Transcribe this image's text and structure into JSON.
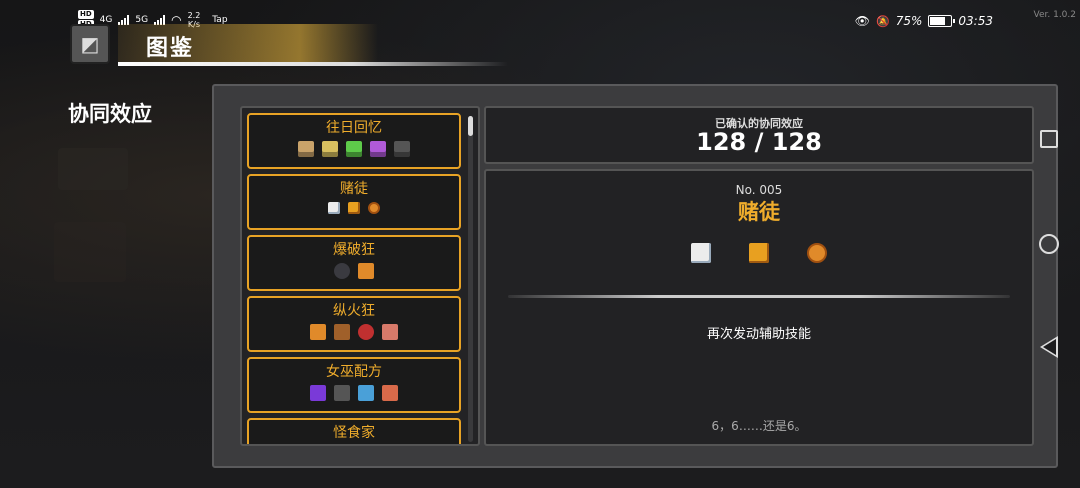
{
  "status_bar": {
    "hd1": "HD",
    "hd2": "HD",
    "net1": "4G",
    "net2": "5G",
    "speed_value": "2.2",
    "speed_unit": "K/s",
    "app_label": "Tap",
    "battery_percent": "75%",
    "battery_level": 0.75,
    "time": "03:53",
    "version": "Ver. 1.0.2"
  },
  "header": {
    "title": "图鉴",
    "back_icon": "back-arrow-icon"
  },
  "side_title": "协同效应",
  "synergy_list": [
    {
      "name": "往日回忆",
      "icons": [
        {
          "name": "memory-card-tan-icon",
          "color": "#c9a36a"
        },
        {
          "name": "memory-card-gold-icon",
          "color": "#d8c060"
        },
        {
          "name": "memory-card-green-icon",
          "color": "#5ecb4a"
        },
        {
          "name": "memory-card-purple-icon",
          "color": "#b05ad8"
        },
        {
          "name": "memory-card-dark-icon",
          "color": "#555555"
        }
      ]
    },
    {
      "name": "赌徒",
      "icons": [
        {
          "name": "dice-white-icon",
          "color": "#ececec"
        },
        {
          "name": "dice-gold-icon",
          "color": "#e8a020"
        },
        {
          "name": "chip-icon",
          "color": "#e08a2a"
        }
      ]
    },
    {
      "name": "爆破狂",
      "icons": [
        {
          "name": "bomb-icon",
          "color": "#3a3a40"
        },
        {
          "name": "boomerang-icon",
          "color": "#e08a2a"
        }
      ]
    },
    {
      "name": "纵火狂",
      "icons": [
        {
          "name": "boomerang-fire-icon",
          "color": "#e08a2a"
        },
        {
          "name": "fire-log-icon",
          "color": "#a0602a"
        },
        {
          "name": "red-orb-icon",
          "color": "#c03030"
        },
        {
          "name": "meat-icon",
          "color": "#d87a6a"
        }
      ]
    },
    {
      "name": "女巫配方",
      "icons": [
        {
          "name": "potion-purple-icon",
          "color": "#7a3ad8"
        },
        {
          "name": "spellbook-icon",
          "color": "#555555"
        },
        {
          "name": "blue-mushroom-icon",
          "color": "#4aa0d8"
        },
        {
          "name": "cauldron-icon",
          "color": "#d86a4a"
        }
      ]
    },
    {
      "name": "怪食家",
      "icons": []
    }
  ],
  "summary": {
    "label": "已确认的协同效应",
    "value": "128 / 128"
  },
  "detail": {
    "number": "No. 005",
    "name": "赌徒",
    "icons": [
      {
        "name": "dice-white-icon",
        "color": "#ececec"
      },
      {
        "name": "dice-gold-icon",
        "color": "#e8a020"
      },
      {
        "name": "chip-icon",
        "color": "#e08a2a"
      }
    ],
    "description": "再次发动辅助技能",
    "flavor": "6，6……还是6。"
  }
}
